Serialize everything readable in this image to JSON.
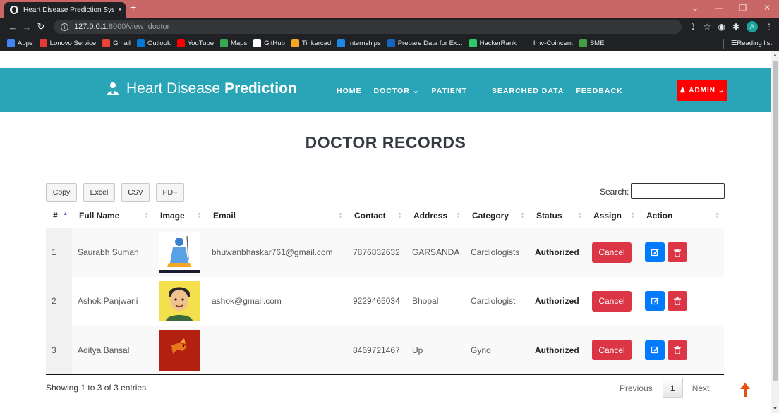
{
  "browser": {
    "tab_title": "Heart Disease Prediction System",
    "tab_close": "×",
    "new_tab": "+",
    "url_host": "127.0.0.1",
    "url_path": ":8000/view_doctor",
    "avatar_letter": "A",
    "bookmarks": [
      {
        "label": "Apps",
        "color": "#4285f4"
      },
      {
        "label": "Lonovo Service",
        "color": "#e53935"
      },
      {
        "label": "Gmail",
        "color": "#ea4335"
      },
      {
        "label": "Outlook",
        "color": "#0078d4"
      },
      {
        "label": "YouTube",
        "color": "#ff0000"
      },
      {
        "label": "Maps",
        "color": "#34a853"
      },
      {
        "label": "GitHub",
        "color": "#ffffff"
      },
      {
        "label": "Tinkercad",
        "color": "#f5a623"
      },
      {
        "label": "Internships",
        "color": "#1e88e5"
      },
      {
        "label": "Prepare Data for Ex...",
        "color": "#1565c0"
      },
      {
        "label": "HackerRank",
        "color": "#2ec866"
      },
      {
        "label": "Imv-Coincent",
        "color": "#202124"
      },
      {
        "label": "SME",
        "color": "#43a047"
      }
    ],
    "reading_list": "Reading list"
  },
  "navbar": {
    "brand_light": "Heart Disease",
    "brand_bold": "Prediction",
    "links": [
      "HOME",
      "DOCTOR ⌄",
      "PATIENT",
      "SEARCHED DATA",
      "FEEDBACK"
    ],
    "admin": "♟ ADMIN ⌄",
    "color": "#2aa5b8"
  },
  "page_title": "DOCTOR RECORDS",
  "table_tools": {
    "buttons": [
      "Copy",
      "Excel",
      "CSV",
      "PDF"
    ],
    "search_label": "Search:",
    "search_value": ""
  },
  "table": {
    "columns": [
      "#",
      "Full Name",
      "Image",
      "Email",
      "Contact",
      "Address",
      "Category",
      "Status",
      "Assign",
      "Action"
    ],
    "rows": [
      {
        "num": "1",
        "name": "Saurabh Suman",
        "image": "shiva-image",
        "email": "bhuwanbhaskar761@gmail.com",
        "contact": "7876832632",
        "address": "GARSANDA",
        "category": "Cardiologists",
        "status": "Authorized",
        "assign": "Cancel"
      },
      {
        "num": "2",
        "name": "Ashok Panjwani",
        "image": "cartoon-avatar-image",
        "email": "ashok@gmail.com",
        "contact": "9229465034",
        "address": "Bhopal",
        "category": "Cardiologist",
        "status": "Authorized",
        "assign": "Cancel"
      },
      {
        "num": "3",
        "name": "Aditya Bansal",
        "image": "red-dragon-image",
        "email": "",
        "contact": "8469721467",
        "address": "Up",
        "category": "Gyno",
        "status": "Authorized",
        "assign": "Cancel"
      }
    ]
  },
  "footer": {
    "info": "Showing 1 to 3 of 3 entries",
    "previous": "Previous",
    "page": "1",
    "next": "Next"
  }
}
